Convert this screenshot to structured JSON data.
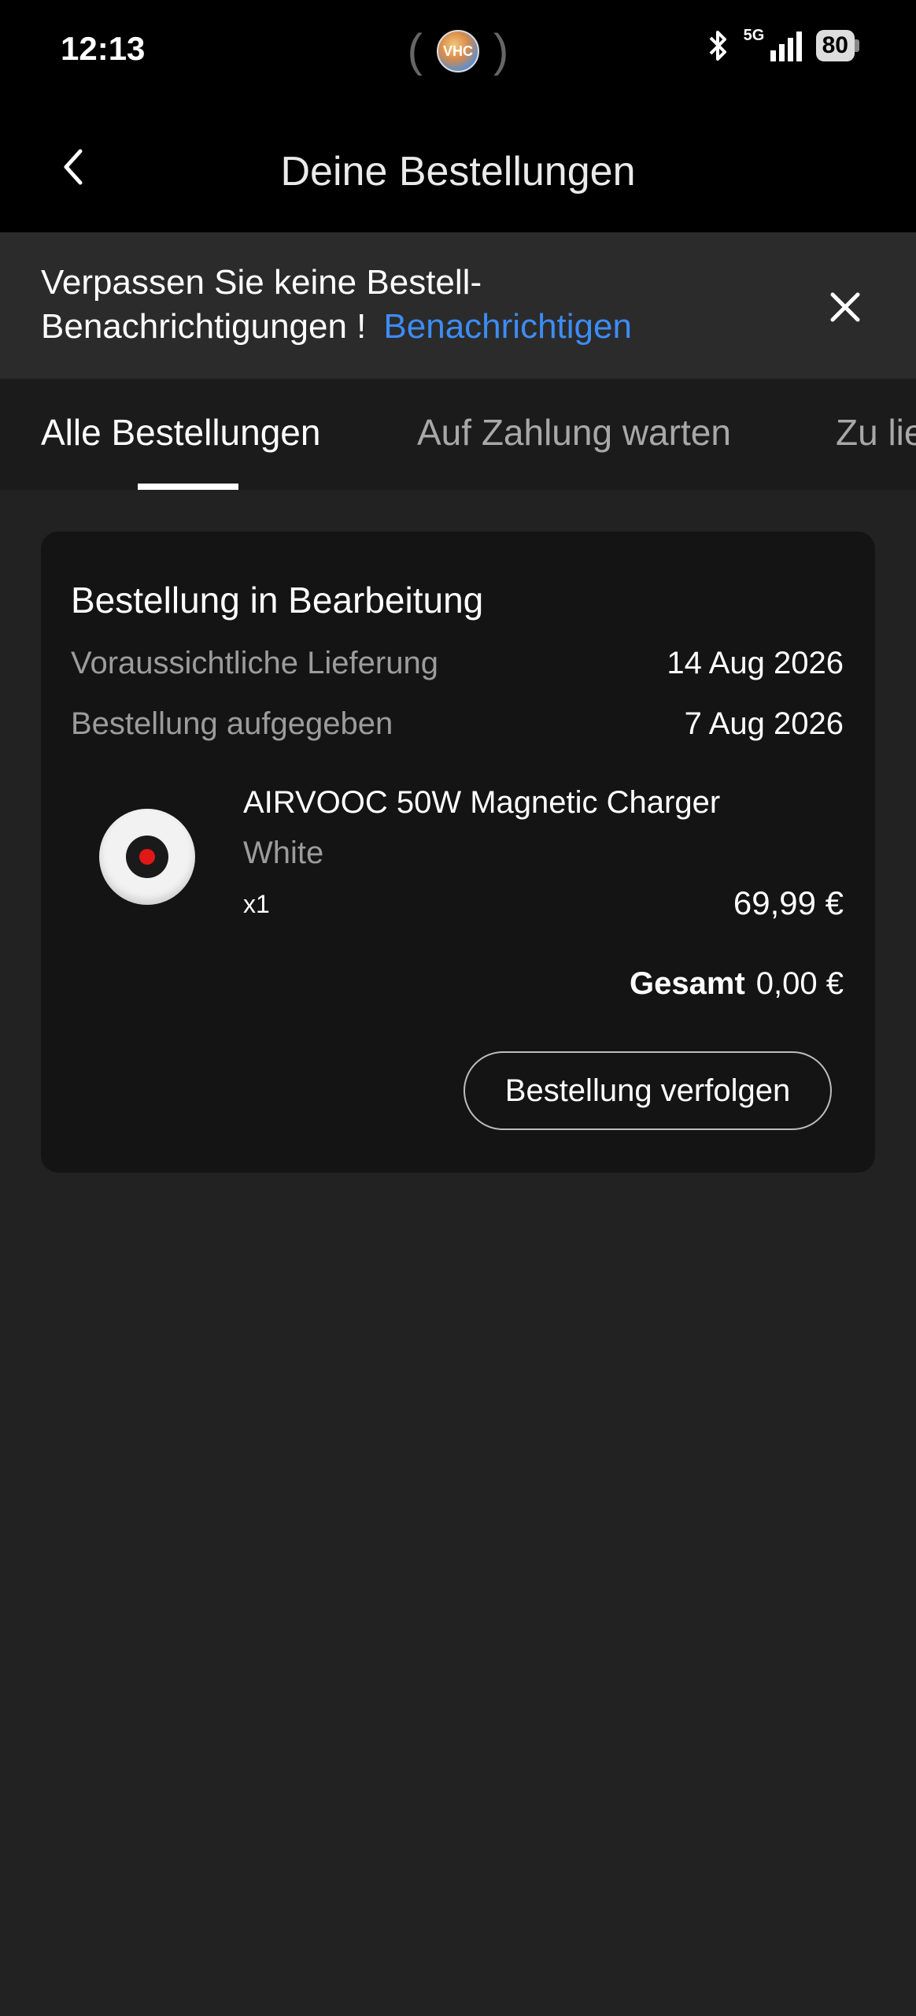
{
  "status_bar": {
    "time": "12:13",
    "center_badge": "VHC",
    "network": "5G",
    "battery": "80"
  },
  "header": {
    "title": "Deine Bestellungen"
  },
  "notification_banner": {
    "text_line1": "Verpassen Sie keine Bestell-",
    "text_line2": "Benachrichtigungen !",
    "link": "Benachrichtigen"
  },
  "tabs": [
    {
      "label": "Alle Bestellungen",
      "active": true
    },
    {
      "label": "Auf Zahlung warten",
      "active": false
    },
    {
      "label": "Zu lie",
      "active": false
    }
  ],
  "order": {
    "status": "Bestellung in Bearbeitung",
    "rows": [
      {
        "label": "Voraussichtliche Lieferung",
        "value": "14 Aug 2026"
      },
      {
        "label": "Bestellung aufgegeben",
        "value": "7 Aug 2026"
      }
    ],
    "product": {
      "name": "AIRVOOC 50W Magnetic Charger",
      "variant": "White",
      "quantity": "x1",
      "price": "69,99 €"
    },
    "total_label": "Gesamt",
    "total_value": "0,00 €",
    "track_button": "Bestellung verfolgen"
  },
  "colors": {
    "link": "#3d8cf5",
    "background": "#222222",
    "card": "#141414"
  }
}
